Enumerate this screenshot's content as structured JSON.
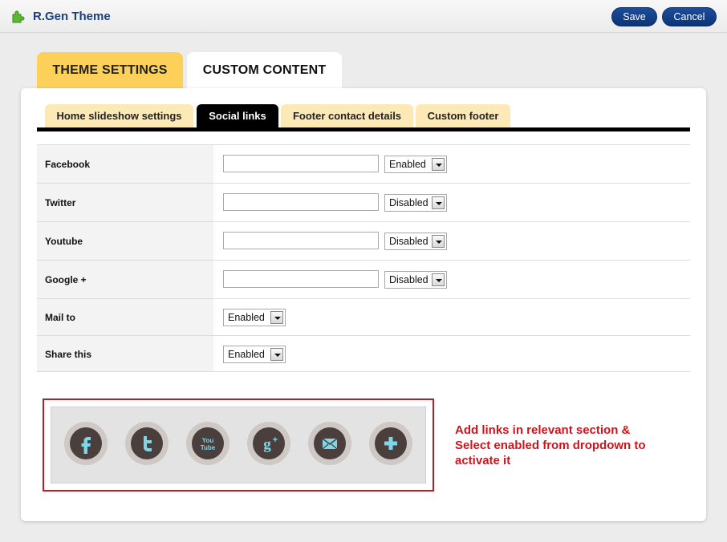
{
  "app": {
    "title": "R.Gen Theme",
    "icon": "puzzle-icon"
  },
  "toolbar": {
    "save_label": "Save",
    "cancel_label": "Cancel"
  },
  "main_tabs": [
    {
      "label": "THEME SETTINGS",
      "active": true
    },
    {
      "label": "CUSTOM CONTENT",
      "active": false
    }
  ],
  "sub_tabs": [
    {
      "label": "Home slideshow settings",
      "active": false
    },
    {
      "label": "Social links",
      "active": true
    },
    {
      "label": "Footer contact details",
      "active": false
    },
    {
      "label": "Custom footer",
      "active": false
    }
  ],
  "rows": [
    {
      "label": "Facebook",
      "value": "",
      "status": "Enabled"
    },
    {
      "label": "Twitter",
      "value": "",
      "status": "Disabled"
    },
    {
      "label": "Youtube",
      "value": "",
      "status": "Disabled"
    },
    {
      "label": "Google +",
      "value": "",
      "status": "Disabled"
    },
    {
      "label": "Mail to",
      "status": "Enabled"
    },
    {
      "label": "Share this",
      "status": "Enabled"
    }
  ],
  "preview": {
    "icons": [
      "facebook-icon",
      "twitter-icon",
      "youtube-icon",
      "google-plus-icon",
      "mail-icon",
      "share-plus-icon"
    ],
    "youtube_text": "You Tube"
  },
  "note": "Add links in relevant section & Select enabled from dropdown to activate it",
  "colors": {
    "brand": "#1c3f7a",
    "accent_tab": "#fdd05a",
    "subtab_bg": "#fde9b6",
    "annotation": "#d0141c",
    "icon_glyph": "#7fd6e6"
  }
}
